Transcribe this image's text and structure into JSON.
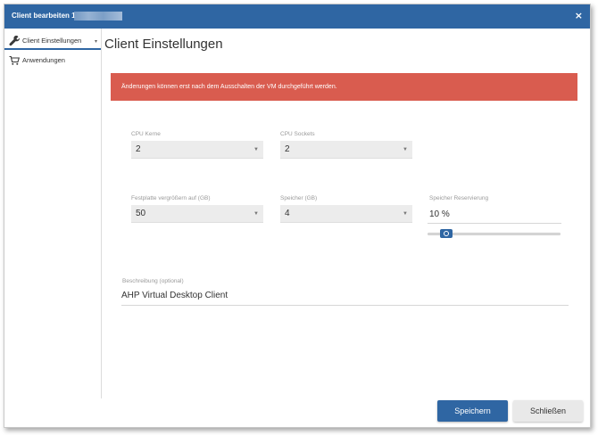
{
  "dialog": {
    "title": "Client bearbeiten 1",
    "close_label": "×"
  },
  "sidebar": {
    "items": [
      {
        "label": "Client Einstellungen",
        "icon": "wrench-icon",
        "active": true,
        "caret": "▾"
      },
      {
        "label": "Anwendungen",
        "icon": "cart-icon",
        "active": false
      }
    ]
  },
  "main": {
    "title": "Client Einstellungen",
    "alert": "Änderungen können erst nach dem Ausschalten der VM durchgeführt werden.",
    "fields": {
      "cpu_cores": {
        "label": "CPU Kerne",
        "value": "2"
      },
      "cpu_sockets": {
        "label": "CPU Sockets",
        "value": "2"
      },
      "disk": {
        "label": "Festplatte vergrößern auf (GB)",
        "value": "50"
      },
      "memory": {
        "label": "Speicher (GB)",
        "value": "4"
      },
      "memory_reservation": {
        "label": "Speicher Reservierung",
        "value": "10 %",
        "level": 0.1
      },
      "description": {
        "label": "Beschreibung (optional)",
        "value": "AHP Virtual Desktop Client"
      }
    },
    "caret_glyph": "▼"
  },
  "footer": {
    "save_label": "Speichern",
    "close_label": "Schließen"
  },
  "colors": {
    "primary": "#2f66a3",
    "alert": "#d95c4f"
  }
}
